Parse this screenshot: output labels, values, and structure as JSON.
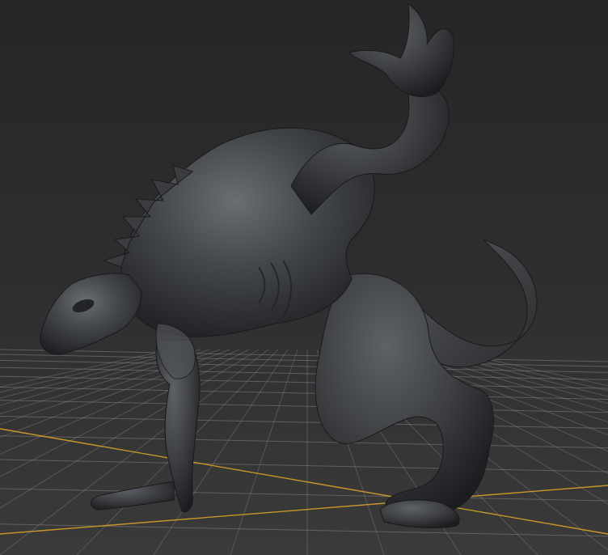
{
  "viewport": {
    "background_top": "#262626",
    "background_bottom": "#3a3a3a",
    "grid_color": "#8a8a8a",
    "axis_color": "#c8962a",
    "model_color": "#3d3f43"
  },
  "scene": {
    "subject": "creature-sculpt-model",
    "grid": true,
    "grid_axes_visible": true
  }
}
